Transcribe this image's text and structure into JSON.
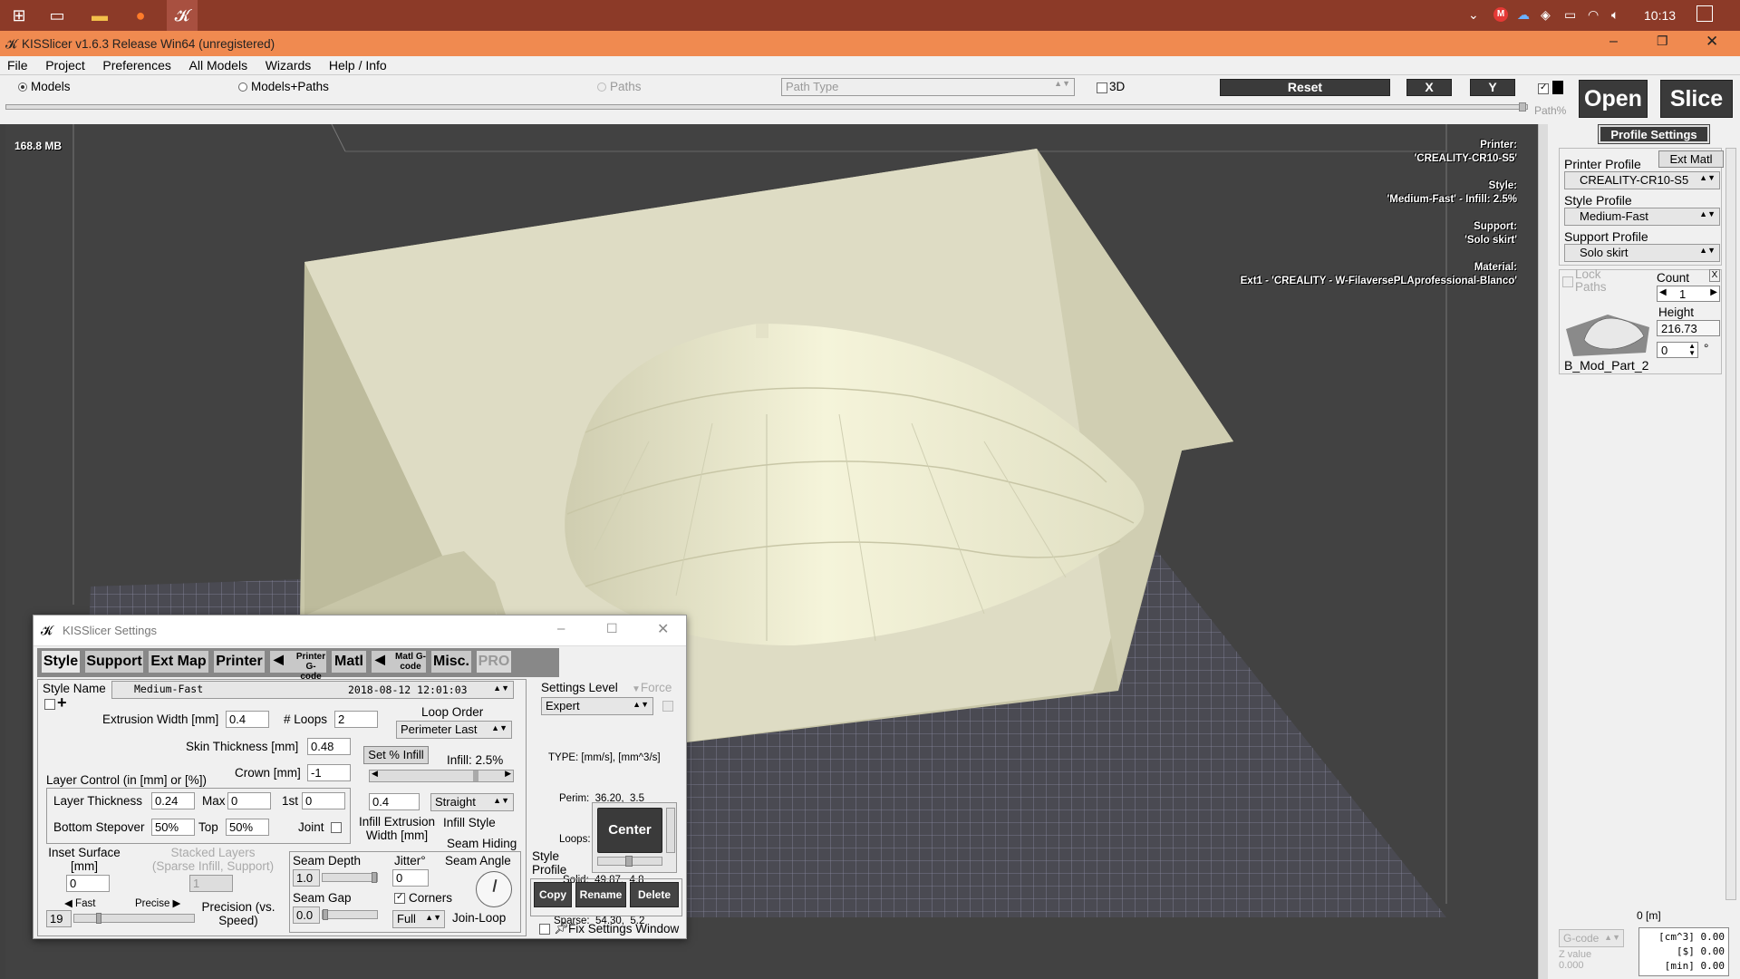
{
  "taskbar": {
    "time": "10:13",
    "icons": [
      "windows-start-icon",
      "task-view-icon",
      "file-explorer-icon",
      "firefox-icon",
      "kisslicer-icon"
    ]
  },
  "window": {
    "title": "KISSlicer v1.6.3 Release Win64 (unregistered)"
  },
  "menu": [
    "File",
    "Project",
    "Preferences",
    "All Models",
    "Wizards",
    "Help / Info"
  ],
  "toolbar": {
    "models": "Models",
    "models_paths": "Models+Paths",
    "paths": "Paths",
    "path_type": "Path Type",
    "three_d": "3D",
    "reset": "Reset",
    "x": "X",
    "y": "Y",
    "open": "Open",
    "slice": "Slice",
    "path_pct": "Path%"
  },
  "viewport": {
    "memory": "168.8 MB",
    "info": [
      {
        "k": "Printer:",
        "v": "'CREALITY-CR10-S5'"
      },
      {
        "k": "Style:",
        "v": "'Medium-Fast' - Infill: 2.5%"
      },
      {
        "k": "Support:",
        "v": "'Solo skirt'"
      },
      {
        "k": "Material:",
        "v": "Ext1 - 'CREALITY - W-FilaversePLAprofessional-Blanco'"
      }
    ]
  },
  "right": {
    "profile_settings": "Profile Settings",
    "printer_profile_label": "Printer Profile",
    "ext_matl": "Ext Matl",
    "printer_profile": "CREALITY-CR10-S5",
    "style_profile_label": "Style Profile",
    "style_profile": "Medium-Fast",
    "support_profile_label": "Support Profile",
    "support_profile": "Solo skirt",
    "lock": "Lock",
    "paths": "Paths",
    "count_label": "Count",
    "count": "1",
    "height_label": "Height",
    "height": "216.73",
    "rotation": "0",
    "deg": "°",
    "model_name": "B_Mod_Part_2",
    "bottom_m": "0 [m]",
    "gcode": "G-code",
    "zvalue": "Z value",
    "zval": "0.000",
    "stats": [
      "[cm^3] 0.00",
      "[$] 0.00",
      "[min] 0.00"
    ],
    "close": "X"
  },
  "dialog": {
    "title": "KISSlicer Settings",
    "tabs": [
      "Style",
      "Support",
      "Ext Map",
      "Printer",
      "Printer G-code",
      "Matl",
      "Matl G-code",
      "Misc.",
      "PRO"
    ],
    "style_name_label": "Style Name",
    "style_name": "Medium-Fast",
    "style_date": "2018-08-12 12:01:03",
    "ext_width_label": "Extrusion Width [mm]",
    "ext_width": "0.4",
    "loops_label": "# Loops",
    "loops": "2",
    "loop_order_label": "Loop Order",
    "loop_order": "Perimeter Last",
    "skin_label": "Skin Thickness [mm]",
    "skin": "0.48",
    "set_infill": "Set % Infill",
    "infill_pct": "Infill: 2.5%",
    "layer_ctrl": "Layer Control (in [mm] or [%])",
    "crown_label": "Crown [mm]",
    "crown": "-1",
    "layer_thick_label": "Layer Thickness",
    "layer_thick": "0.24",
    "max_label": "Max",
    "max": "0",
    "first_label": "1st",
    "first": "0",
    "bottom_step_label": "Bottom Stepover",
    "bottom_step": "50%",
    "top_label": "Top",
    "top": "50%",
    "joint_label": "Joint",
    "infill_width": "0.4",
    "infill_width_label": "Infill Extrusion Width [mm]",
    "infill_style": "Straight",
    "infill_style_label": "Infill Style",
    "inset_label": "Inset Surface [mm]",
    "inset": "0",
    "stacked_label": "Stacked Layers (Sparse Infill, Support)",
    "stacked": "1",
    "fast": "Fast",
    "precise": "Precise",
    "precision_val": "19",
    "precision_label": "Precision (vs. Speed)",
    "seam_hiding": "Seam Hiding",
    "seam_depth_label": "Seam Depth",
    "seam_depth": "1.0",
    "jitter_label": "Jitter°",
    "jitter": "0",
    "seam_angle_label": "Seam Angle",
    "seam_gap_label": "Seam Gap",
    "seam_gap": "0.0",
    "corners_label": "Corners",
    "join_loop_mode": "Full",
    "join_loop_label": "Join-Loop",
    "settings_level_label": "Settings Level",
    "force_label": "Force",
    "settings_level": "Expert",
    "types": [
      "TYPE: [mm/s], [mm^3/s]",
      "Perim:  36.20,  3.5",
      "Loops:  58.35,  5.6",
      "Solid:  49.87,  4.8",
      "Sparse:  54.30,  5.2"
    ],
    "center": "Center",
    "style_profile_label": "Style Profile",
    "copy": "Copy",
    "rename": "Rename",
    "delete": "Delete",
    "fix_window": "Fix Settings Window"
  }
}
